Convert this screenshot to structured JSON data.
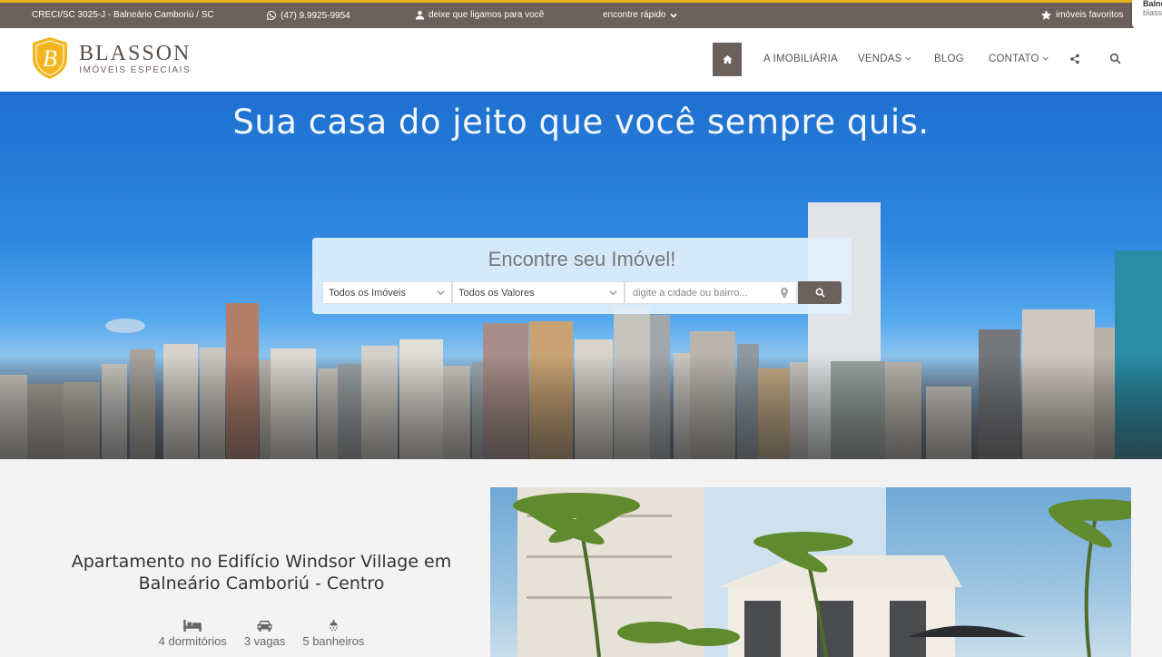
{
  "topbar": {
    "creci": "CRECI/SC 3025-J - Balneário Camboriú / SC",
    "phone": "(47) 9.9925-9954",
    "callback": "deixe que ligamos para você",
    "quick_find": "encontre rápido",
    "favorites": "imóveis favoritos"
  },
  "toast": {
    "line1": "Balne",
    "line2": "blass"
  },
  "brand": {
    "name": "BLASSON",
    "tagline": "IMÓVEIS ESPECIAIS",
    "colors": {
      "gold": "#f2b51d",
      "brown": "#6b605b"
    }
  },
  "nav": {
    "items": [
      "A IMOBILIÁRIA",
      "VENDAS",
      "BLOG",
      "CONTATO"
    ],
    "icons": [
      "home-icon",
      "share-icon",
      "search-icon"
    ]
  },
  "hero": {
    "title": "Sua casa do jeito que você sempre quis.",
    "search": {
      "title": "Encontre seu Imóvel!",
      "type_select": "Todos os Imóveis",
      "value_select": "Todos os Valores",
      "city_placeholder": "digite a cidade ou bairro..."
    }
  },
  "featured": {
    "title": "Apartamento no Edifício Windsor Village em Balneário Camboriú - Centro",
    "stats": [
      {
        "icon": "bed-icon",
        "label": "4 dormitórios"
      },
      {
        "icon": "car-icon",
        "label": "3 vagas"
      },
      {
        "icon": "shower-icon",
        "label": "5 banheiros"
      }
    ]
  }
}
